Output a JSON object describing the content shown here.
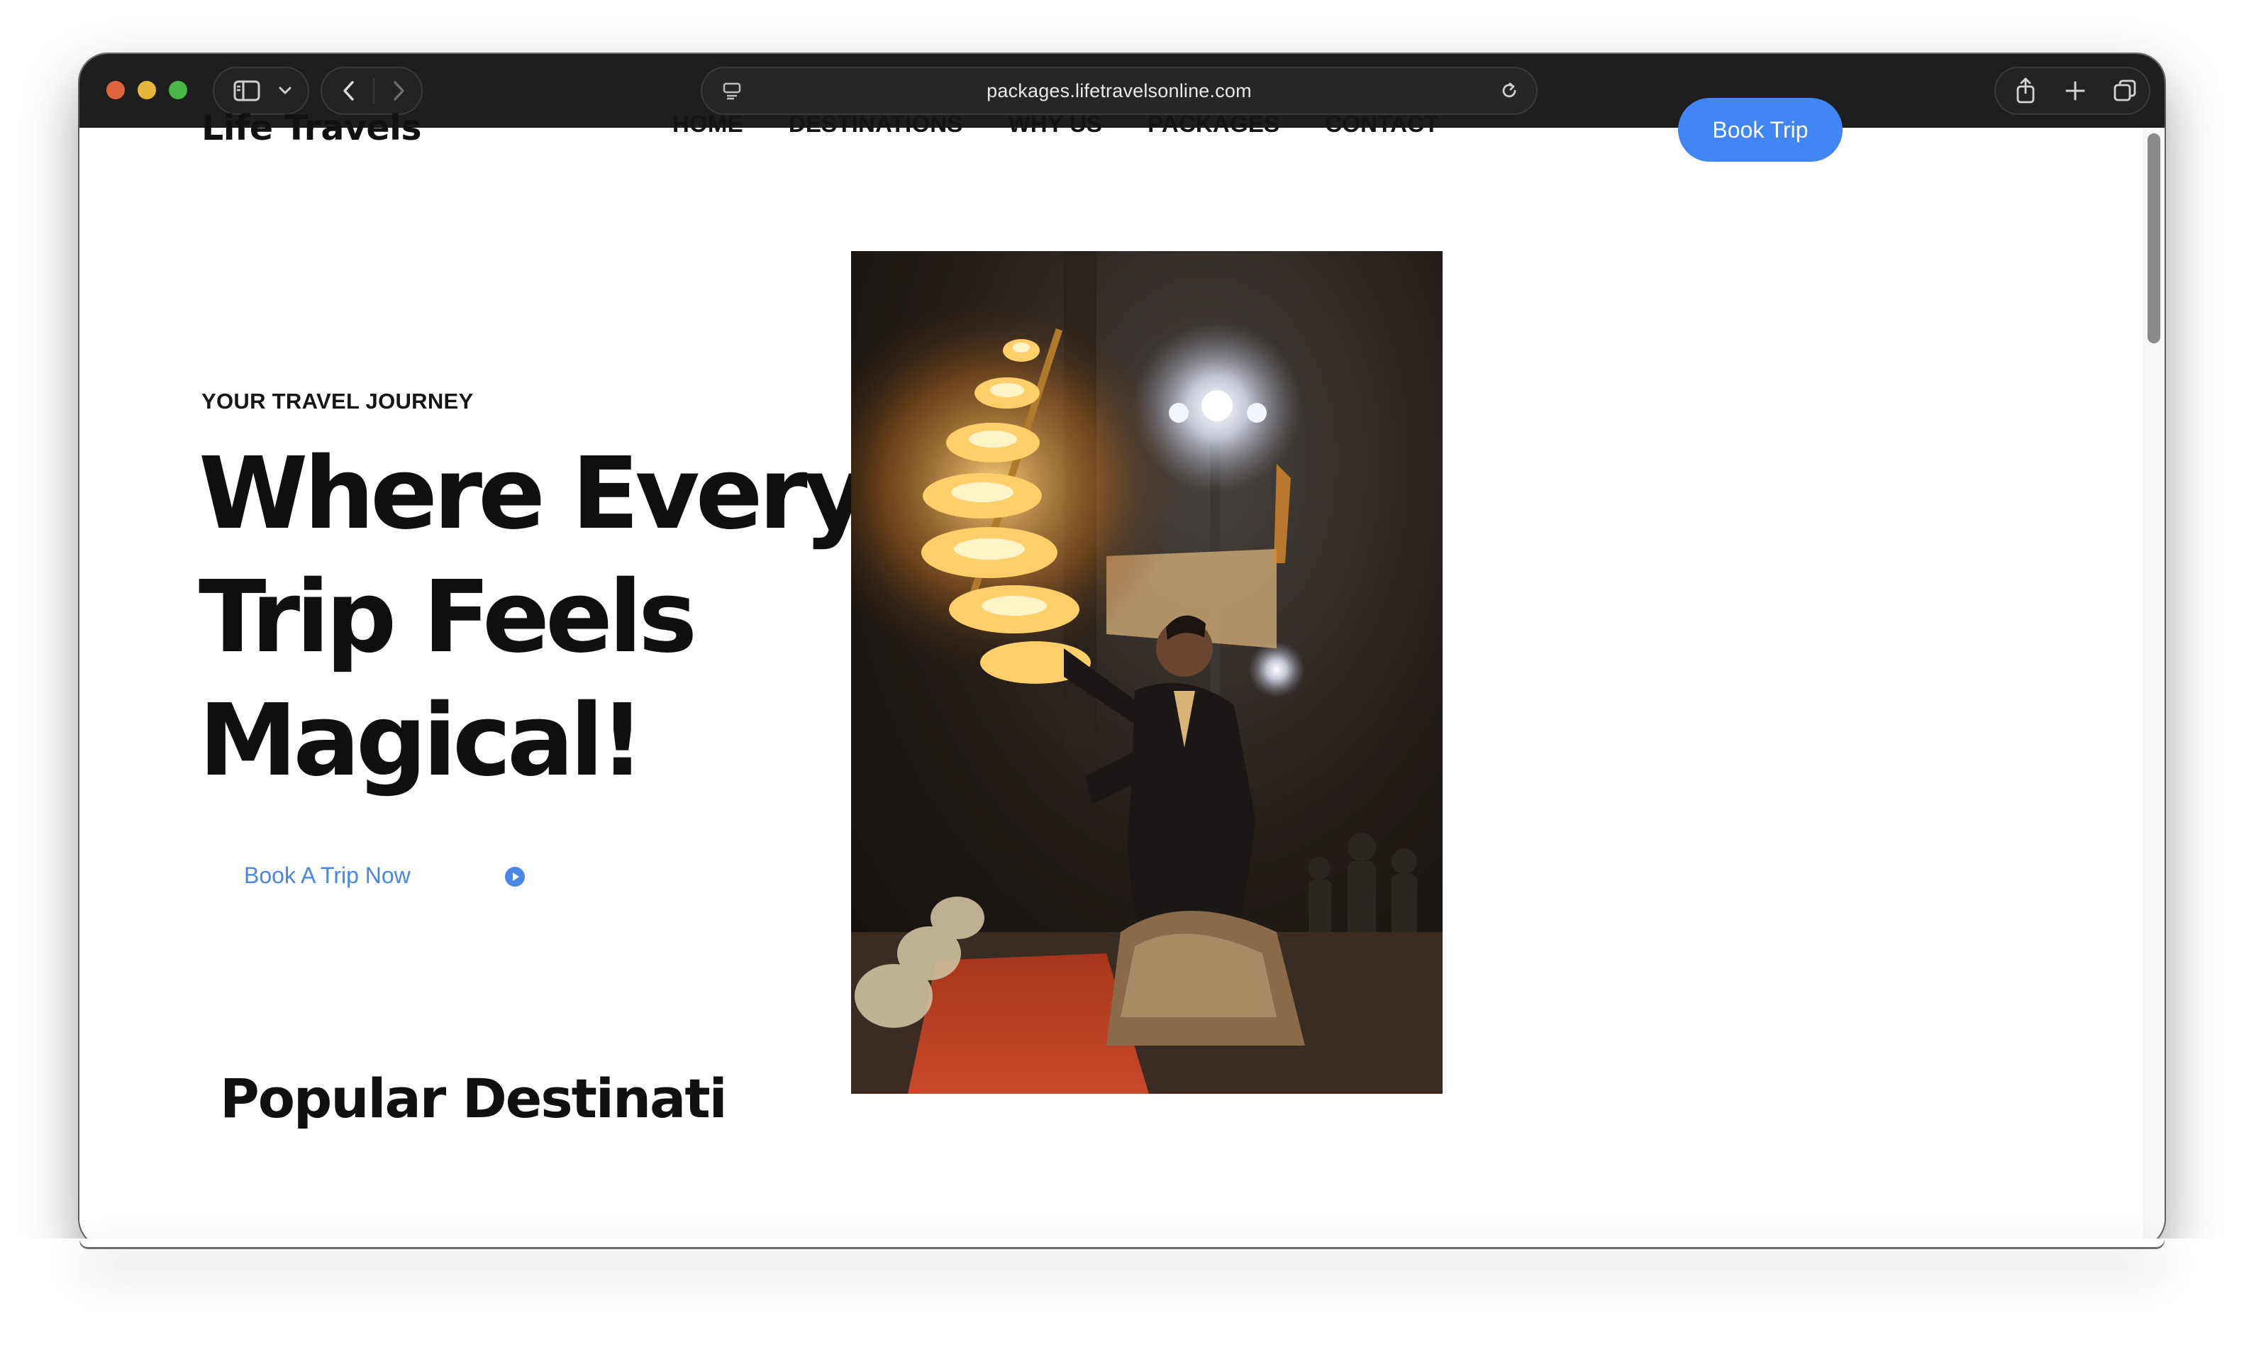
{
  "browser": {
    "url": "packages.lifetravelsonline.com",
    "icons": [
      "sidebar-icon",
      "chevron-down-icon",
      "back-icon",
      "forward-icon",
      "reader-icon",
      "reload-icon",
      "share-icon",
      "new-tab-icon",
      "tabs-overview-icon"
    ]
  },
  "site": {
    "logo": "Life Travels",
    "nav": [
      "HOME",
      "DESTINATIONS",
      "WHY US",
      "PACKAGES",
      "CONTACT"
    ],
    "book_button": "Book Trip"
  },
  "hero": {
    "eyebrow": "YOUR TRAVEL JOURNEY",
    "headline": [
      "Where Every",
      "Trip Feels",
      "Magical!"
    ],
    "cta_label": "Book A Trip Now",
    "image_alt": "Priest performing evening aarti ceremony with a multi-tiered brass fire lamp at night"
  },
  "next_section": {
    "heading_partial": "Popular Destinati"
  },
  "colors": {
    "accent": "#4285f4",
    "toolbar": "#1e1e1e",
    "text": "#111111"
  }
}
